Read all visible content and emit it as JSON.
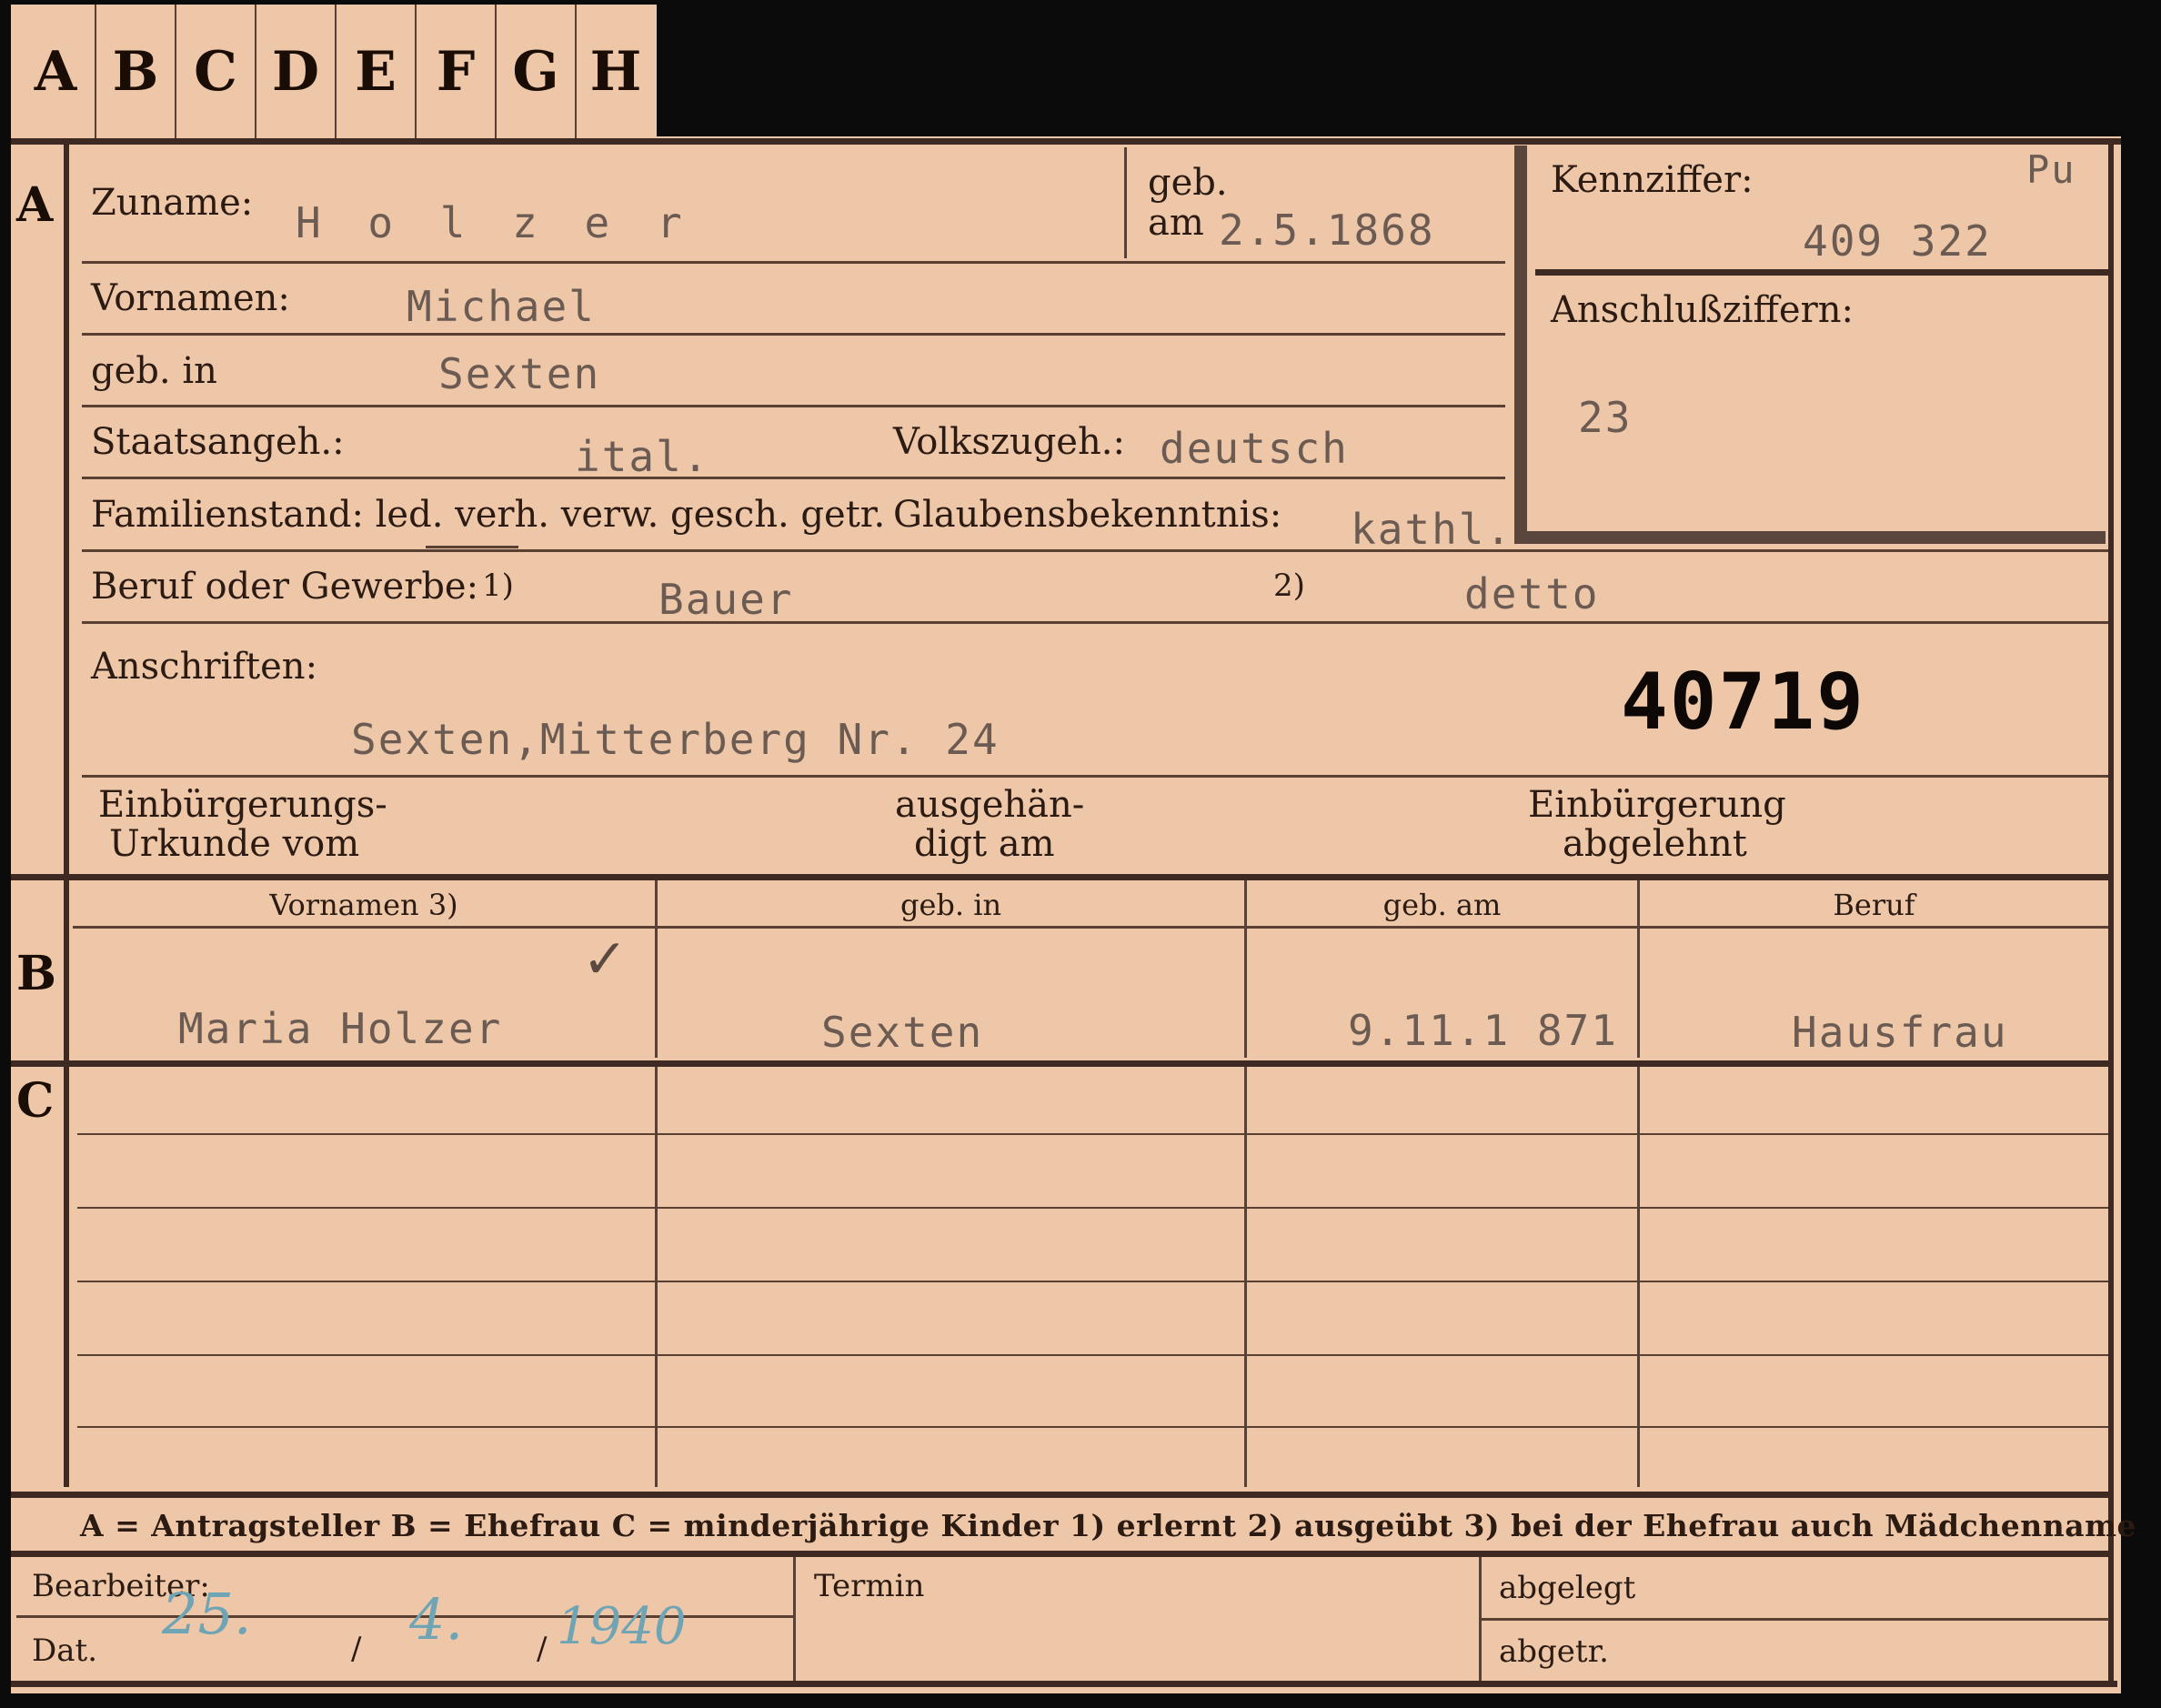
{
  "tabs": [
    "A",
    "B",
    "C",
    "D",
    "E",
    "F",
    "G",
    "H"
  ],
  "section_marks": {
    "a": "A",
    "b": "B",
    "c": "C"
  },
  "applicant": {
    "surname_label": "Zuname:",
    "surname": "H o l z e r",
    "geb_label": "geb.",
    "am_label": "am",
    "birth_date": "2.5.1868",
    "firstnames_label": "Vornamen:",
    "firstnames": "Michael",
    "birthplace_label": "geb. in",
    "birthplace": "Sexten",
    "citizenship_label": "Staatsangeh.:",
    "citizenship": "ital.",
    "ethnicity_label": "Volkszugeh.:",
    "ethnicity": "deutsch",
    "marital_label": "Familienstand: led. verh. verw. gesch. getr.",
    "religion_label": "Glaubensbekenntnis:",
    "religion": "kathl.",
    "occupation_label": "Beruf oder Gewerbe:",
    "occ_note1": "1)",
    "occupation": "Bauer",
    "occ_note2": "2)",
    "occupation_practiced": "detto",
    "address_label": "Anschriften:",
    "address": "Sexten,Mitterberg Nr. 24",
    "stamp_number": "40719",
    "naturalization_doc_label_1": "Einbürgerungs-",
    "naturalization_doc_label_2": "Urkunde vom",
    "handed_label_1": "ausgehän-",
    "handed_label_2": "digt am",
    "refused_label_1": "Einbürgerung",
    "refused_label_2": "abgelehnt"
  },
  "id_box": {
    "kennziffer_label": "Kennziffer:",
    "pu": "Pu",
    "kennziffer": "409 322",
    "anschluss_label": "Anschlußziffern:",
    "anschluss": "23"
  },
  "spouse_table": {
    "headers": [
      "Vornamen 3)",
      "geb. in",
      "geb. am",
      "Beruf"
    ],
    "row": [
      "Maria Holzer",
      "Sexten",
      "9.11.1 871",
      "Hausfrau"
    ],
    "check": "✓"
  },
  "legend": "A = Antragsteller   B = Ehefrau   C = minderjährige Kinder   1) erlernt   2) ausgeübt   3) bei der Ehefrau auch Mädchenname",
  "footer": {
    "clerk_label": "Bearbeiter:",
    "date_label": "Dat.",
    "date_day": "25.",
    "date_month": "4.",
    "date_year": "1940",
    "sep": "/",
    "termin_label": "Termin",
    "filed_label": "abgelegt",
    "filed2_label": "abgetr."
  },
  "colors": {
    "paper": "#eec7a8",
    "ink": "#2b1b12",
    "typewriter": "#6b5b52",
    "pencil": "#6fa4b4"
  }
}
